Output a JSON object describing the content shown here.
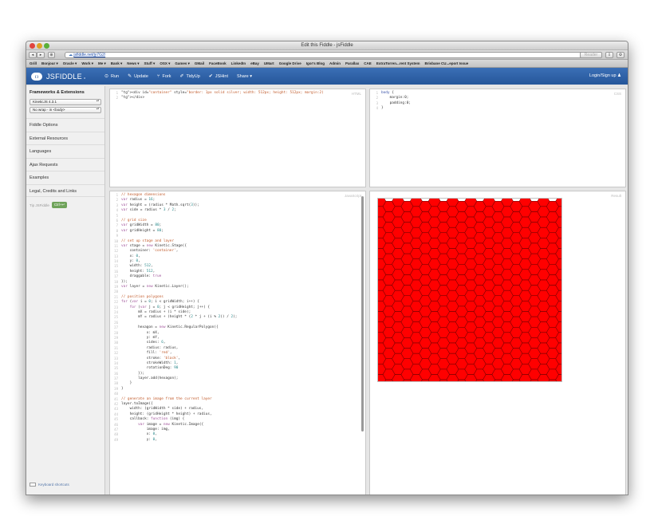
{
  "window": {
    "title": "Edit this Fiddle - jsFiddle"
  },
  "navbar": {
    "url": "jsfiddle.net/jy7G2/",
    "reader_label": "Reader"
  },
  "bookmarks": [
    "Grill",
    "Bonjour ▾",
    "Oracle ▾",
    "Work ▾",
    "Me ▾",
    "Bank ▾",
    "News ▾",
    "Stuff ▾",
    "OSX ▾",
    "Games ▾",
    "GMail",
    "FaceBook",
    "LinkedIn",
    "eBay",
    "UMart",
    "Google Drive",
    "Igor's Blog",
    "Admin",
    "Parallax",
    "CAE",
    "ExtraTorren...rent System",
    "Brisbane CU...eport Issue"
  ],
  "header": {
    "logo_text": "JSFIDDLE",
    "logo_badge": "α",
    "buttons": [
      {
        "icon": "⊙",
        "label": "Run"
      },
      {
        "icon": "✎",
        "label": "Update"
      },
      {
        "icon": "⑂",
        "label": "Fork"
      },
      {
        "icon": "✐",
        "label": "TidyUp"
      },
      {
        "icon": "✔",
        "label": "JSHint"
      },
      {
        "icon": "",
        "label": "Share ▾"
      }
    ],
    "login": "Login/Sign up ♟"
  },
  "sidebar": {
    "title": "Frameworks & Extensions",
    "framework": "KineticJS 4.3.1",
    "wrap": "No wrap - in <body>",
    "items": [
      "Fiddle Options",
      "External Resources",
      "Languages",
      "Ajax Requests",
      "Examples",
      "Legal, Credits and Links"
    ],
    "tip": "Tip JSFiddle",
    "tip_badge": "Ctrl+↵",
    "keyboard": "Keyboard shortcuts"
  },
  "panels": {
    "html_label": "HTML",
    "css_label": "CSS",
    "js_label": "JavaScript",
    "result_label": "Result"
  },
  "html_code": [
    "<div id=\"container\" style=\"border: 1px solid silver; width: 512px; height: 512px; margin:2(",
    "</div>"
  ],
  "css_code": [
    "body {",
    "    margin:0;",
    "    padding:0;",
    "}"
  ],
  "js_code": [
    "// hexagon dimensions",
    "var radius = 16;",
    "var height = (radius * Math.sqrt(3));",
    "var side = radius * 3 / 2;",
    "",
    "// grid size",
    "var gridWidth = 80;",
    "var gridHeight = 80;",
    "",
    "// set up stage and layer",
    "var stage = new Kinetic.Stage({",
    "    container: 'container',",
    "    x: 0,",
    "    y: 0,",
    "    width: 512,",
    "    height: 512,",
    "    draggable: true",
    "});",
    "var layer = new Kinetic.Layer();",
    "",
    "// position polygons",
    "for (var i = 0; i < gridWidth; i++) {",
    "    for (var j = 0; j < gridHeight; j++) {",
    "        mX = radius + (i * side);",
    "        mY = radius + (height * (2 * j + (i % 2)) / 2);",
    "",
    "        hexagon = new Kinetic.RegularPolygon({",
    "            x: mX,",
    "            y: mY,",
    "            sides: 6,",
    "            radius: radius,",
    "            fill: 'red',",
    "            stroke: 'black',",
    "            strokeWidth: 1,",
    "            rotationDeg: 90",
    "        });",
    "        layer.add(hexagon);",
    "    }",
    "}",
    "",
    "// generate an image from the current layer",
    "layer.toImage({",
    "    width: (gridWidth * side) + radius,",
    "    height: (gridHeight * height) + radius,",
    "    callback: function (img) {",
    "        var image = new Kinetic.Image({",
    "            image: img,",
    "            x: 0,",
    "            y: 0,"
  ],
  "colors": {
    "hex_fill": "#ff0000",
    "hex_stroke": "#5a0000",
    "header_blue": "#2f63aa"
  }
}
